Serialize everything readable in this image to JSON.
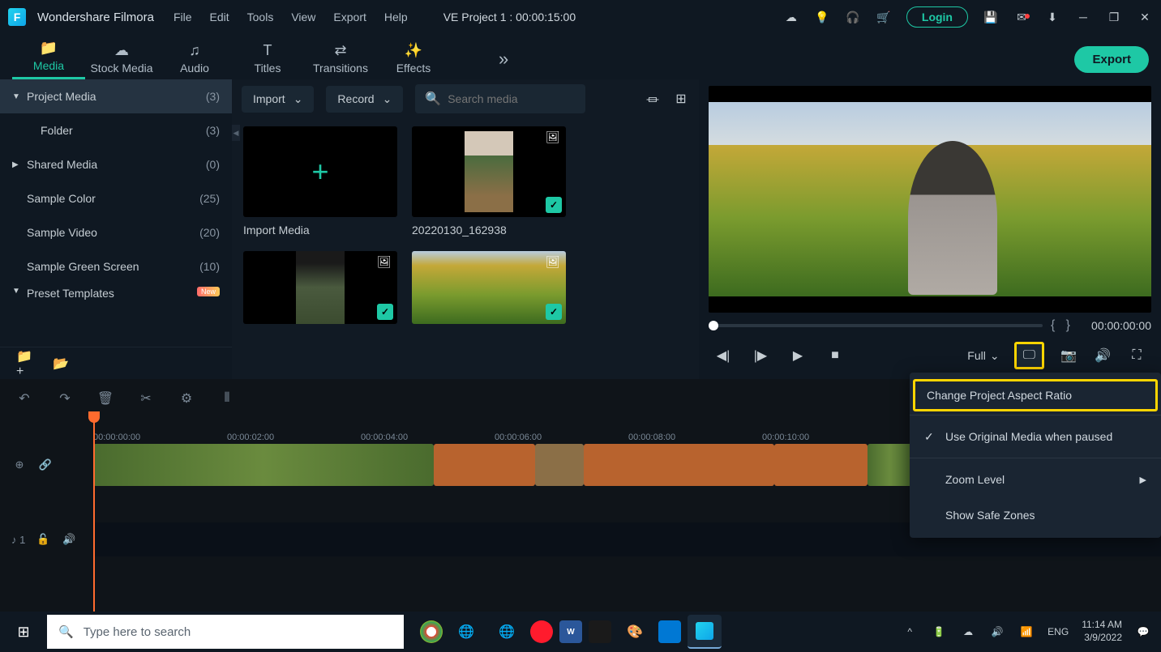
{
  "app": {
    "name": "Wondershare Filmora",
    "project_title": "VE Project 1 : 00:00:15:00"
  },
  "menu": [
    "File",
    "Edit",
    "Tools",
    "View",
    "Export",
    "Help"
  ],
  "login_label": "Login",
  "nav_tabs": [
    {
      "label": "Media",
      "active": true
    },
    {
      "label": "Stock Media",
      "active": false
    },
    {
      "label": "Audio",
      "active": false
    },
    {
      "label": "Titles",
      "active": false
    },
    {
      "label": "Transitions",
      "active": false
    },
    {
      "label": "Effects",
      "active": false
    }
  ],
  "export_label": "Export",
  "sidebar": {
    "items": [
      {
        "label": "Project Media",
        "count": "(3)",
        "active": true,
        "caret": "▼"
      },
      {
        "label": "Folder",
        "count": "(3)",
        "indent": true
      },
      {
        "label": "Shared Media",
        "count": "(0)",
        "caret": "▶"
      },
      {
        "label": "Sample Color",
        "count": "(25)"
      },
      {
        "label": "Sample Video",
        "count": "(20)"
      },
      {
        "label": "Sample Green Screen",
        "count": "(10)"
      },
      {
        "label": "Preset Templates",
        "new": true,
        "caret": "▼"
      }
    ]
  },
  "media_toolbar": {
    "import": "Import",
    "record": "Record",
    "search_placeholder": "Search media"
  },
  "media_items": [
    {
      "title": "Import Media",
      "type": "add"
    },
    {
      "title": "20220130_162938",
      "type": "video",
      "checked": true
    }
  ],
  "preview": {
    "time": "00:00:00:00",
    "full_label": "Full"
  },
  "popup": {
    "change_aspect": "Change Project Aspect Ratio",
    "use_original": "Use Original Media when paused",
    "zoom_level": "Zoom Level",
    "safe_zones": "Show Safe Zones"
  },
  "timeline": {
    "marks": [
      "00:00:00:00",
      "00:00:02:00",
      "00:00:04:00",
      "00:00:06:00",
      "00:00:08:00",
      "00:00:10:00"
    ],
    "audio_track_label": "♪ 1"
  },
  "taskbar": {
    "search_placeholder": "Type here to search",
    "lang": "ENG",
    "time": "11:14 AM",
    "date": "3/9/2022"
  }
}
